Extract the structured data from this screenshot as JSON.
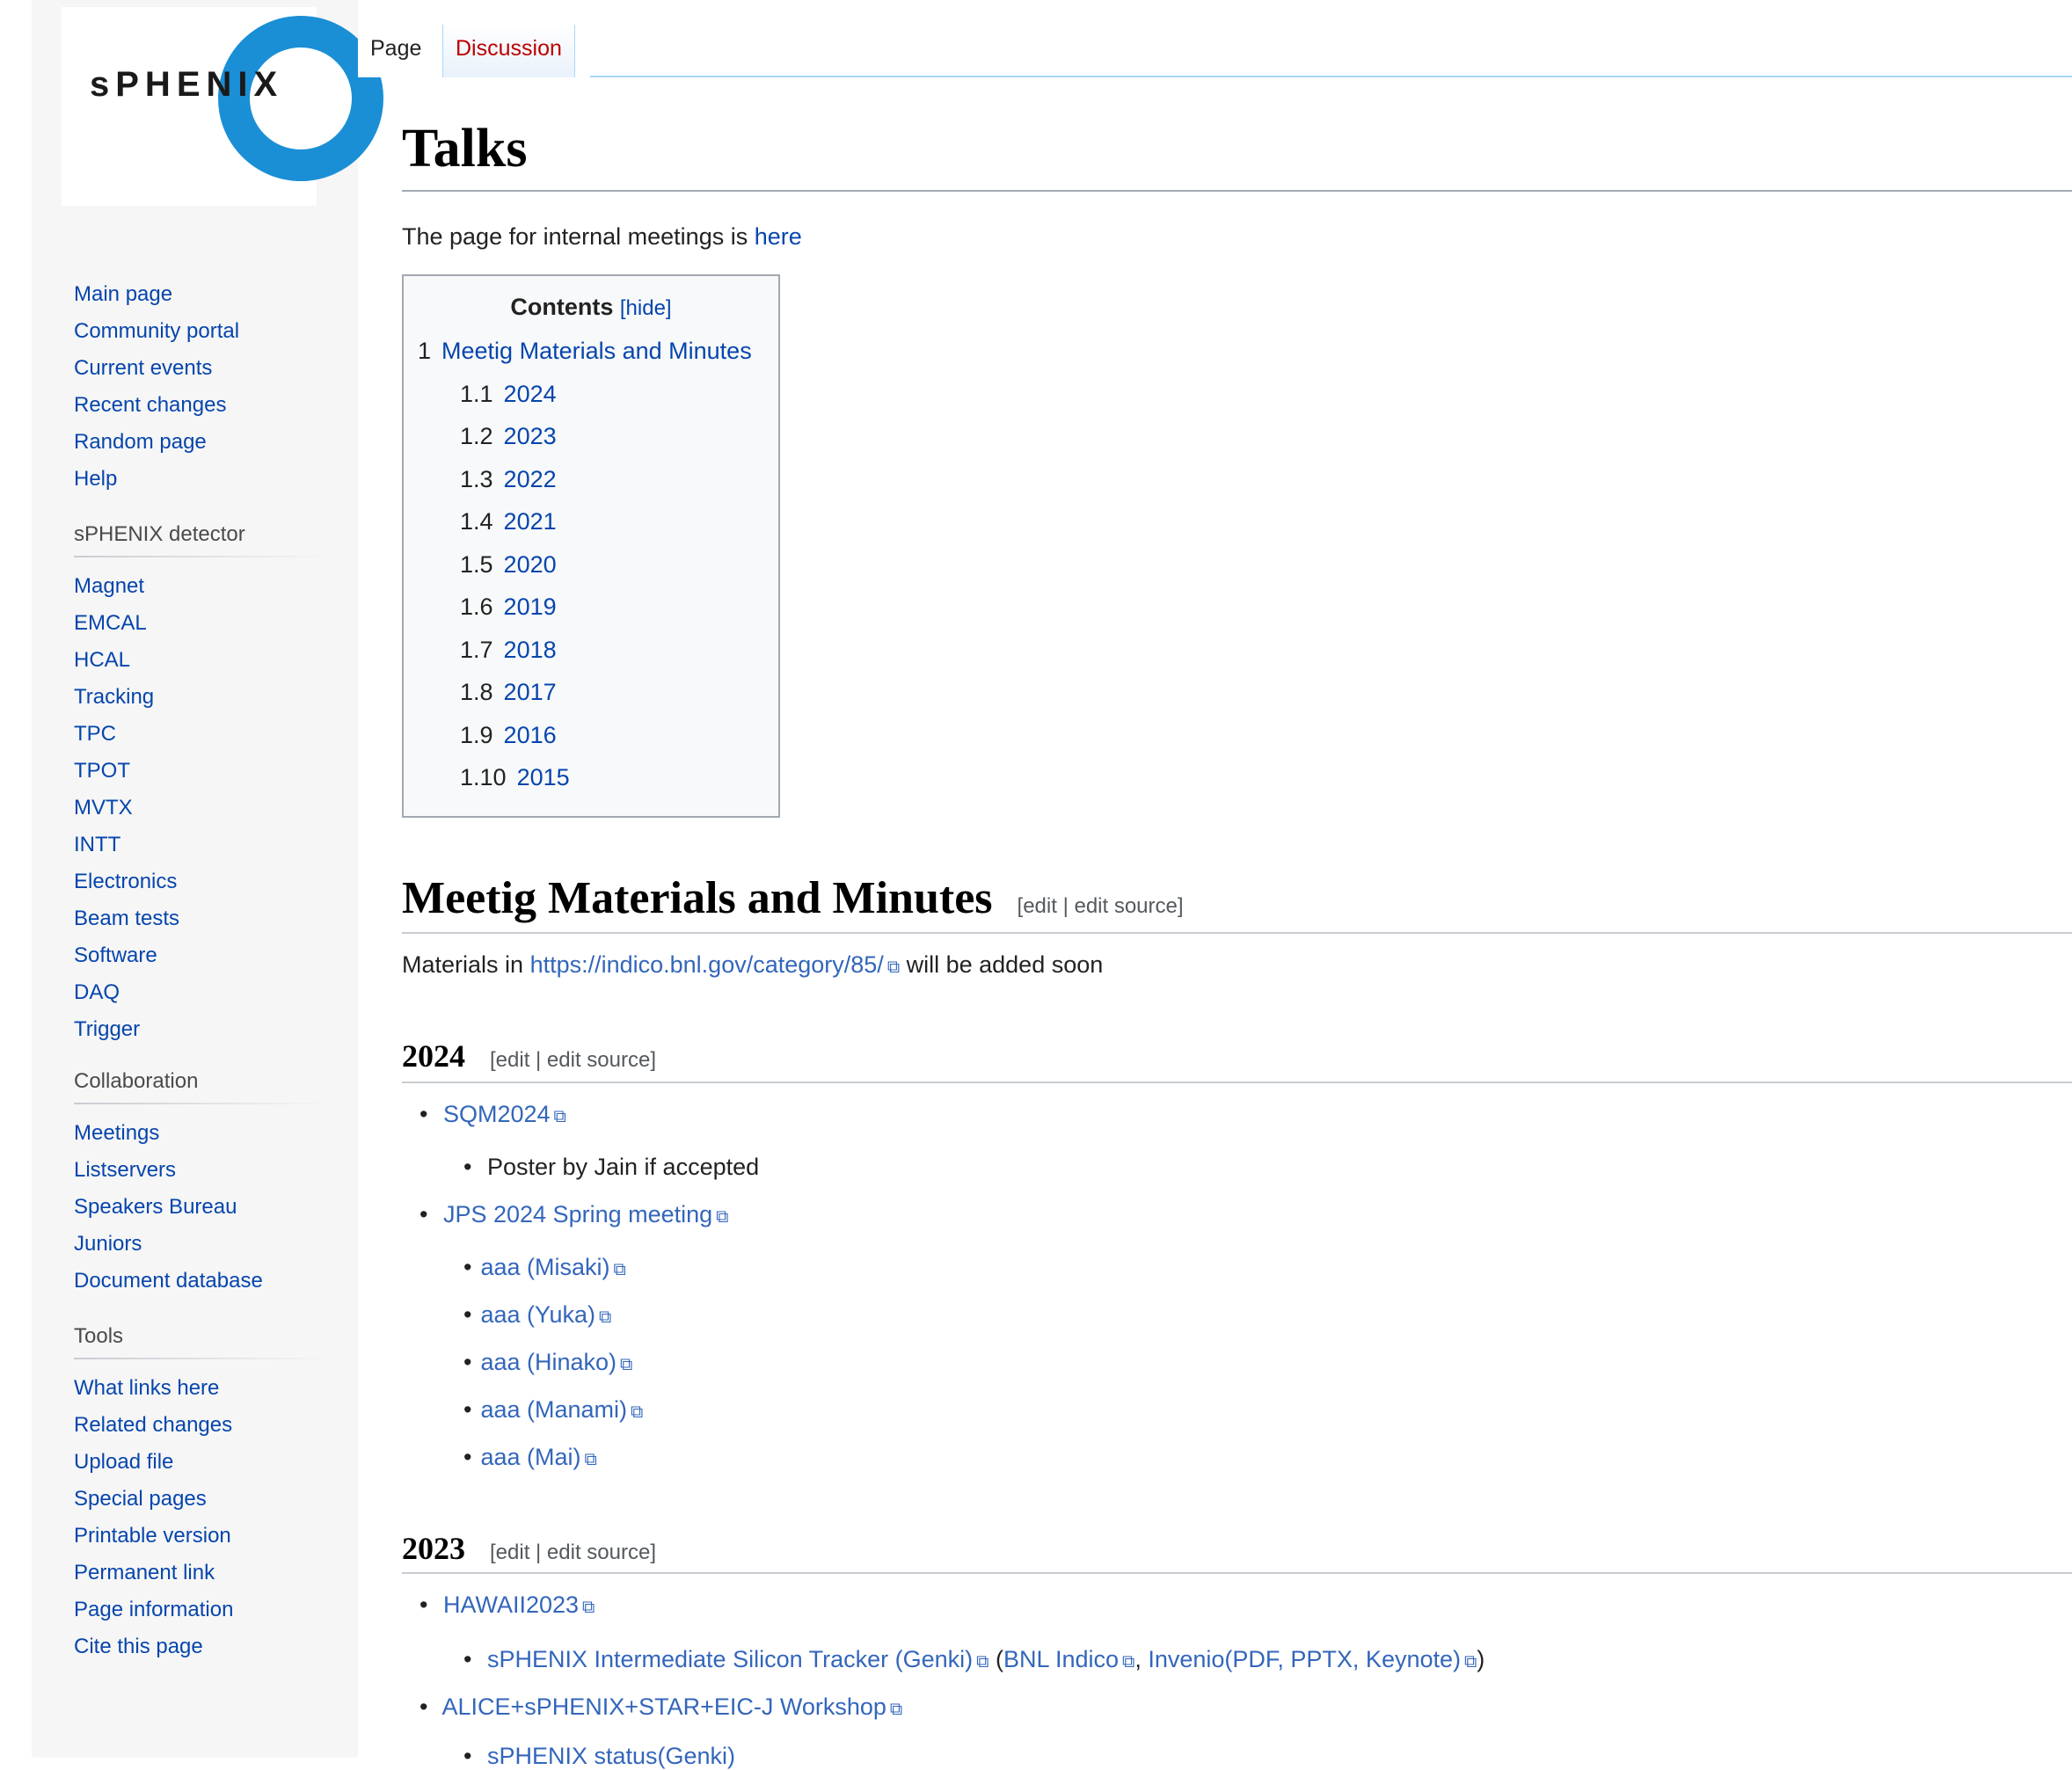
{
  "logo": {
    "text": "sPHENIX"
  },
  "sidebar": {
    "navigation": [
      "Main page",
      "Community portal",
      "Current events",
      "Recent changes",
      "Random page",
      "Help"
    ],
    "detector": {
      "heading": "sPHENIX detector",
      "items": [
        "Magnet",
        "EMCAL",
        "HCAL",
        "Tracking",
        "TPC",
        "TPOT",
        "MVTX",
        "INTT",
        "Electronics",
        "Beam tests",
        "Software",
        "DAQ",
        "Trigger"
      ]
    },
    "collaboration": {
      "heading": "Collaboration",
      "items": [
        "Meetings",
        "Listservers",
        "Speakers Bureau",
        "Juniors",
        "Document database"
      ]
    },
    "tools": {
      "heading": "Tools",
      "items": [
        "What links here",
        "Related changes",
        "Upload file",
        "Special pages",
        "Printable version",
        "Permanent link",
        "Page information",
        "Cite this page"
      ]
    }
  },
  "tabs": {
    "page": "Page",
    "discussion": "Discussion"
  },
  "content": {
    "title": "Talks",
    "intro_text": "The page for internal meetings is",
    "intro_link": "here",
    "toc": {
      "title": "Contents",
      "hide": "[hide]",
      "items": [
        {
          "num": "1",
          "label": "Meetig Materials and Minutes"
        },
        {
          "num": "1.1",
          "label": "2024"
        },
        {
          "num": "1.2",
          "label": "2023"
        },
        {
          "num": "1.3",
          "label": "2022"
        },
        {
          "num": "1.4",
          "label": "2021"
        },
        {
          "num": "1.5",
          "label": "2020"
        },
        {
          "num": "1.6",
          "label": "2019"
        },
        {
          "num": "1.7",
          "label": "2018"
        },
        {
          "num": "1.8",
          "label": "2017"
        },
        {
          "num": "1.9",
          "label": "2016"
        },
        {
          "num": "1.10",
          "label": "2015"
        }
      ]
    },
    "section": {
      "heading": "Meetig Materials and Minutes",
      "edit": "[edit | edit source]",
      "materials_prefix": "Materials in",
      "materials_link": "https://indico.bnl.gov/category/85/",
      "materials_suffix": "will be added soon"
    },
    "y2024": {
      "heading": "2024",
      "edit": "[edit | edit source]",
      "sqm": "SQM2024",
      "poster": "Poster by Jain if accepted",
      "jps": "JPS 2024 Spring meeting",
      "talks": [
        "aaa (Misaki)",
        "aaa (Yuka)",
        "aaa (Hinako)",
        "aaa (Manami)",
        "aaa (Mai)"
      ]
    },
    "y2023": {
      "heading": "2023",
      "edit": "[edit | edit source]",
      "hawaii": "HAWAII2023",
      "intt": "sPHENIX Intermediate Silicon Tracker (Genki)",
      "paren_open": "(",
      "bnl": "BNL Indico",
      "comma": ",",
      "invenio": "Invenio(PDF, PPTX, Keynote)",
      "paren_close": ")",
      "alice": "ALICE+sPHENIX+STAR+EIC-J Workshop",
      "status_partial": "sPHENIX status(Genki)"
    }
  }
}
